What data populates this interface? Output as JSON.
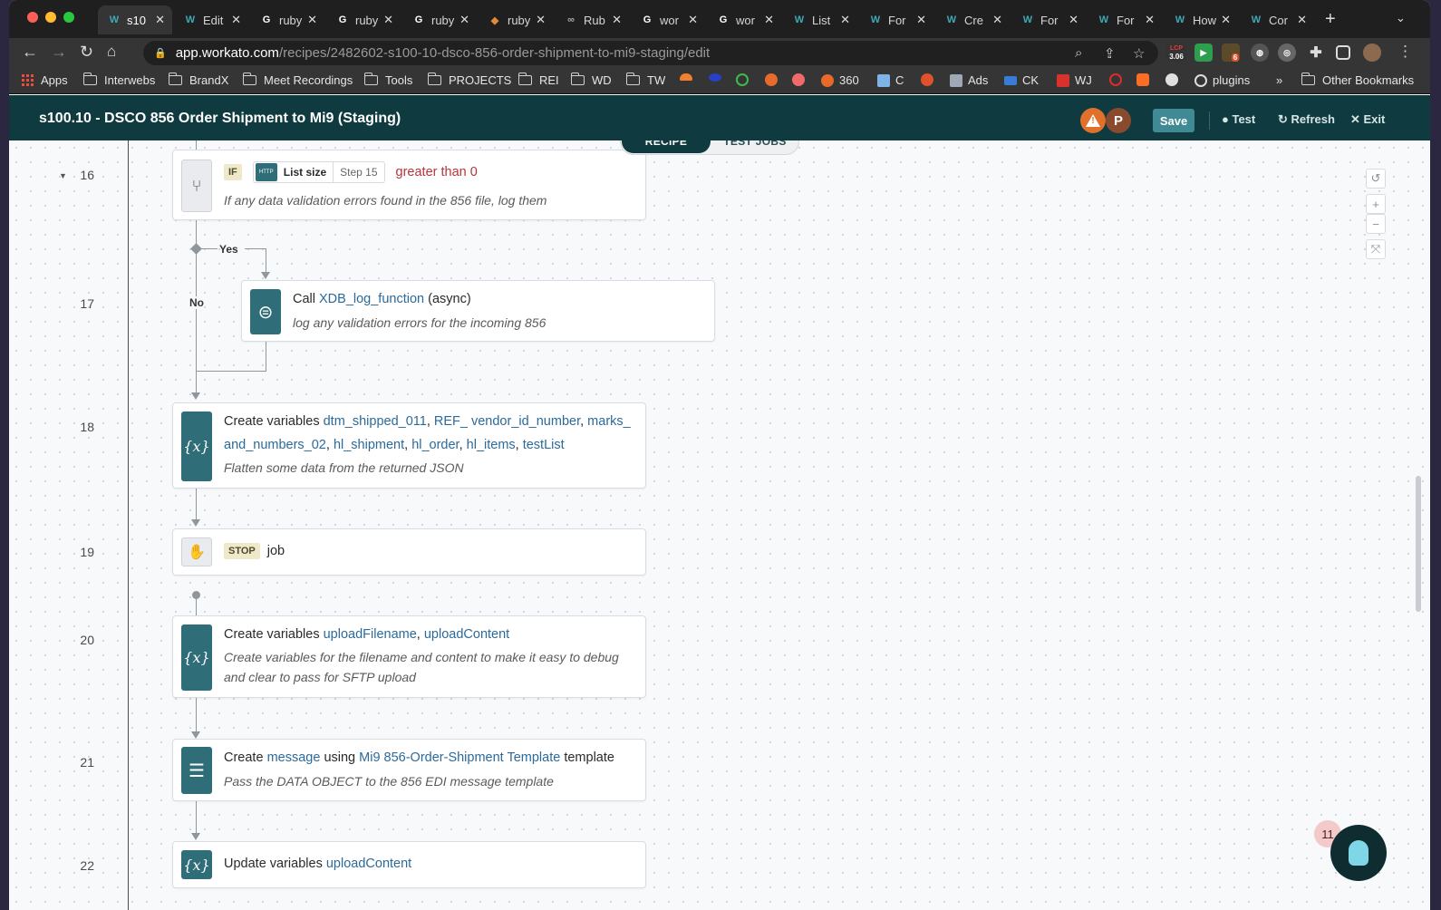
{
  "browser": {
    "tabs": [
      {
        "label": "s10",
        "icon": "workato-icon",
        "active": true
      },
      {
        "label": "Edit",
        "icon": "workato-icon"
      },
      {
        "label": "ruby",
        "icon": "google-icon"
      },
      {
        "label": "ruby",
        "icon": "google-icon"
      },
      {
        "label": "ruby",
        "icon": "google-icon"
      },
      {
        "label": "ruby",
        "icon": "ruby-icon"
      },
      {
        "label": "Rub",
        "icon": "link-icon"
      },
      {
        "label": "wor",
        "icon": "google-icon"
      },
      {
        "label": "wor",
        "icon": "google-icon"
      },
      {
        "label": "List",
        "icon": "workato-icon"
      },
      {
        "label": "For",
        "icon": "workato-icon"
      },
      {
        "label": "Cre",
        "icon": "workato-icon"
      },
      {
        "label": "For",
        "icon": "workato-icon"
      },
      {
        "label": "For",
        "icon": "workato-icon"
      },
      {
        "label": "How",
        "icon": "workato-icon"
      },
      {
        "label": "Cor",
        "icon": "workato-icon"
      }
    ],
    "url_host": "app.workato.com",
    "url_path": "/recipes/2482602-s100-10-dsco-856-order-shipment-to-mi9-staging/edit",
    "ext_badge": "3.06",
    "ext_badge_top": "LCP",
    "ext_count": "6",
    "bookmarks": {
      "apps": "Apps",
      "interwebs": "Interwebs",
      "brandx": "BrandX",
      "meet": "Meet Recordings",
      "tools": "Tools",
      "projects": "PROJECTS",
      "rei": "REI",
      "wd": "WD",
      "tw": "TW",
      "b360": "360",
      "c": "C",
      "ads": "Ads",
      "ck": "CK",
      "wj": "WJ",
      "plugins": "plugins",
      "more": "»",
      "other": "Other Bookmarks"
    }
  },
  "header": {
    "title": "s100.10 - DSCO 856 Order Shipment to Mi9 (Staging)",
    "avatar_letter": "P",
    "warning": "!",
    "save": "Save",
    "test": "Test",
    "refresh": "Refresh",
    "exit": "Exit"
  },
  "toggle": {
    "recipe": "RECIPE",
    "test_jobs": "TEST JOBS"
  },
  "steps": {
    "s16": {
      "num": "16",
      "keyword": "IF",
      "pill_icon": "HTTP",
      "pill_label": "List size",
      "pill_step": "Step 15",
      "condition": "greater than 0",
      "desc": "If any data validation errors found in the 856 file, log them"
    },
    "branch_yes": "Yes",
    "branch_no": "No",
    "s17": {
      "num": "17",
      "prefix": "Call",
      "func": "XDB_log_function",
      "suffix": "(async)",
      "desc": "log any validation errors for the incoming 856"
    },
    "s18": {
      "num": "18",
      "prefix": "Create variables",
      "v1": "dtm_shipped_011",
      "v2": "REF_ vendor_id_number",
      "v3a": "marks_",
      "v3b": "and_numbers_02",
      "v4": "hl_shipment",
      "v5": "hl_order",
      "v6": "hl_items",
      "v7": "testList",
      "desc": "Flatten some data from the returned JSON"
    },
    "s19": {
      "num": "19",
      "keyword": "STOP",
      "text": "job"
    },
    "s20": {
      "num": "20",
      "prefix": "Create variables",
      "v1": "uploadFilename",
      "v2": "uploadContent",
      "desc1": "Create variables for the filename and content to make it easy to debug",
      "desc2": "and clear to pass for SFTP upload"
    },
    "s21": {
      "num": "21",
      "w1": "Create",
      "l1": "message",
      "w2": "using",
      "l2": "Mi9 856-Order-Shipment Template",
      "w3": "template",
      "desc": "Pass the DATA OBJECT to the 856 EDI message template"
    },
    "s22": {
      "num": "22",
      "prefix": "Update variables",
      "v1": "uploadContent"
    }
  },
  "help": {
    "badge": "11"
  },
  "colors": {
    "header_bg": "#0f3a40",
    "step_icon": "#2f6e78",
    "link": "#2b6a9a",
    "condition": "#b4353b"
  }
}
